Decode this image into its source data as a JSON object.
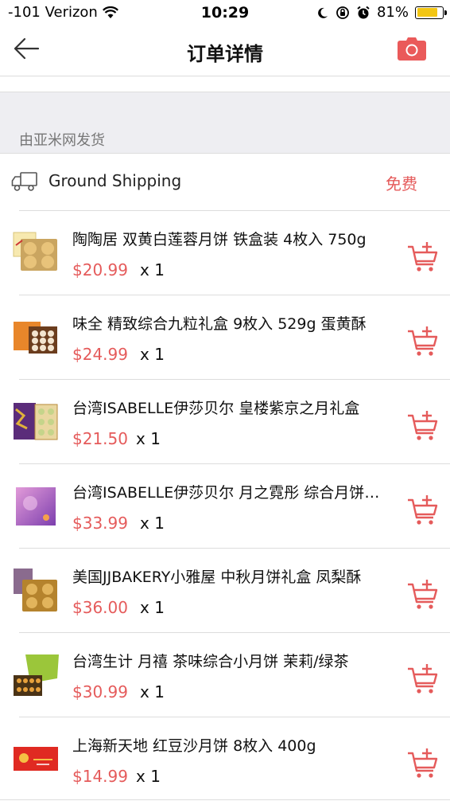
{
  "status": {
    "carrier": "-101 Verizon",
    "time": "10:29",
    "battery": "81%",
    "battery_level": 0.81
  },
  "nav": {
    "title": "订单详情",
    "back_icon": "back-arrow-icon",
    "camera_icon": "camera-icon"
  },
  "order": {
    "seller": "由亚米网发货",
    "shipping_method": "Ground Shipping",
    "shipping_fee": "免费"
  },
  "items": [
    {
      "name": "陶陶居 双黄白莲蓉月饼 铁盒装 4枚入 750g",
      "price": "$20.99",
      "qty": "x 1"
    },
    {
      "name": "味全 精致综合九粒礼盒 9枚入 529g 蛋黄酥",
      "price": "$24.99",
      "qty": "x 1"
    },
    {
      "name": "台湾ISABELLE伊莎贝尔 皇楼紫京之月礼盒",
      "price": "$21.50",
      "qty": "x 1"
    },
    {
      "name": "台湾ISABELLE伊莎贝尔 月之霓彤 综合月饼礼盒",
      "price": "$33.99",
      "qty": "x 1"
    },
    {
      "name": "美国JJBAKERY小雅屋 中秋月饼礼盒 凤梨酥",
      "price": "$36.00",
      "qty": "x 1"
    },
    {
      "name": "台湾生计 月禧 茶味综合小月饼 茉莉/绿茶",
      "price": "$30.99",
      "qty": "x 1"
    },
    {
      "name": "上海新天地 红豆沙月饼 8枚入 400g",
      "price": "$14.99",
      "qty": "x 1"
    }
  ],
  "colors": {
    "accent": "#e55b5b",
    "battery": "#f3c613"
  }
}
